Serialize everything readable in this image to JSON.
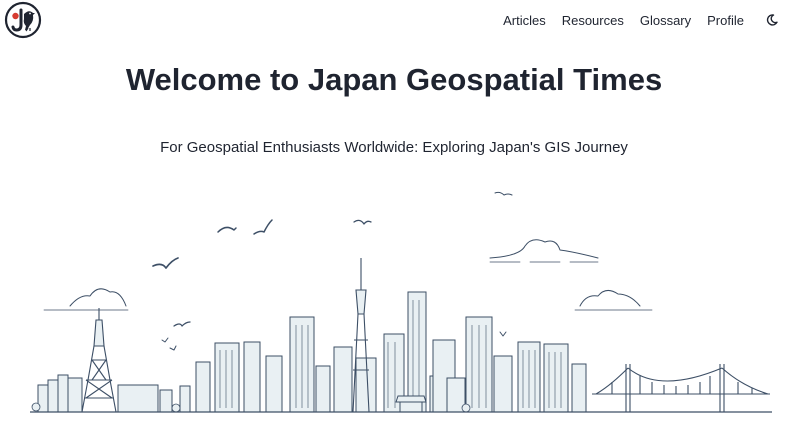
{
  "brand": {
    "logo_icon": "bird-letter-j-logo",
    "accent_red": "#d63b30"
  },
  "nav": {
    "items": [
      {
        "label": "Articles"
      },
      {
        "label": "Resources"
      },
      {
        "label": "Glossary"
      },
      {
        "label": "Profile"
      }
    ],
    "theme_toggle_icon": "moon-icon"
  },
  "hero": {
    "title": "Welcome to Japan Geospatial Times",
    "subtitle": "For Geospatial Enthusiasts Worldwide: Exploring Japan's GIS Journey",
    "illustration_icon": "tokyo-skyline-illustration"
  },
  "colors": {
    "text": "#1f2430",
    "line": "#3d4f66",
    "tint": "#e4edf1"
  }
}
